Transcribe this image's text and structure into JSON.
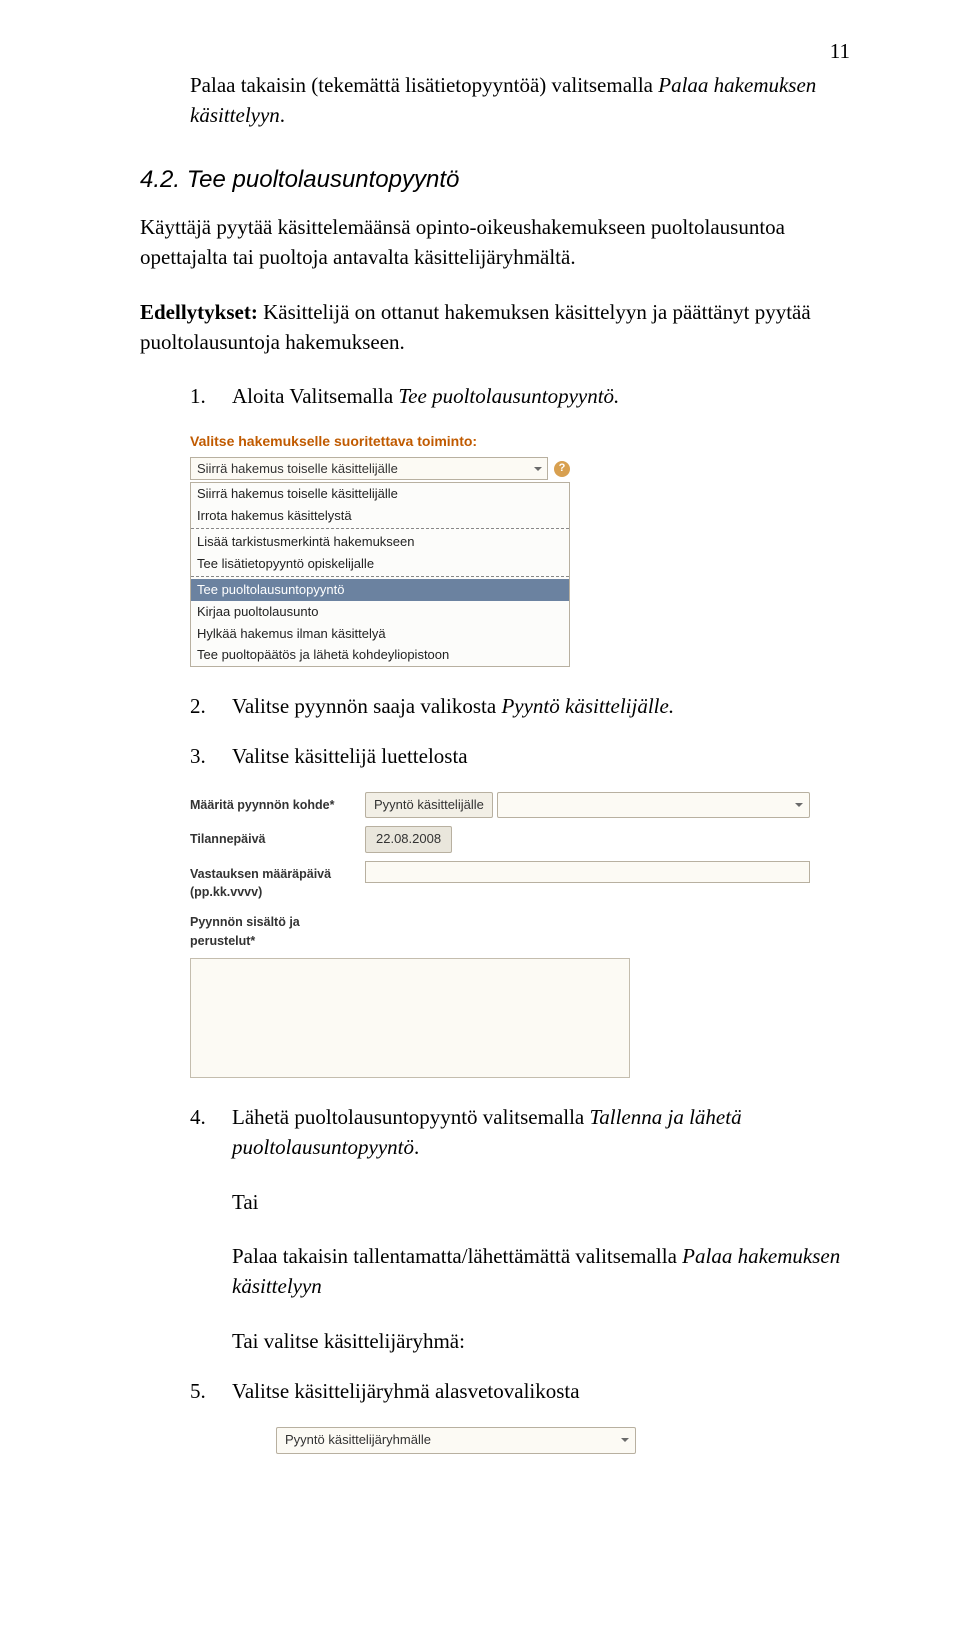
{
  "page_number": "11",
  "intro": {
    "line1_a": "Palaa takaisin (tekemättä lisätietopyyntöä) valitsemalla ",
    "line1_i": "Palaa hakemuksen käsittelyyn",
    "line1_b": "."
  },
  "section": {
    "num": "4.2.",
    "title": "Tee puoltolausuntopyyntö"
  },
  "p1": "Käyttäjä pyytää käsittelemäänsä opinto-oikeushakemukseen  puoltolausuntoa opettajalta tai puoltoja antavalta käsittelijäryhmältä.",
  "p2_a": "Edellytykset:",
  "p2_b": " Käsittelijä on ottanut hakemuksen käsittelyyn ja päättänyt pyytää puoltolausuntoja hakemukseen.",
  "steps": {
    "s1_a": "Aloita Valitsemalla ",
    "s1_i": "Tee puoltolausuntopyyntö.",
    "s2_a": "Valitse pyynnön saaja valikosta ",
    "s2_i": "Pyyntö käsittelijälle.",
    "s3": "Valitse käsittelijä luettelosta",
    "s4_a": "Lähetä puoltolausuntopyyntö valitsemalla ",
    "s4_i": "Tallenna ja lähetä puoltolausuntopyyntö",
    "s4_b": ".",
    "tai": "Tai",
    "s4c_a": "Palaa takaisin tallentamatta/lähettämättä valitsemalla ",
    "s4c_i": "Palaa hakemuksen käsittelyyn",
    "s4d": "Tai valitse käsittelijäryhmä:",
    "s5": "Valitse käsittelijäryhmä alasvetovalikosta"
  },
  "img1": {
    "title": "Valitse hakemukselle suoritettava toiminto:",
    "selected": "Siirrä hakemus toiselle käsittelijälle",
    "help": "?",
    "options": [
      "Siirrä hakemus toiselle käsittelijälle",
      "Irrota hakemus käsittelystä",
      "---",
      "Lisää tarkistusmerkintä hakemukseen",
      "Tee lisätietopyyntö opiskelijalle",
      "---",
      "Tee puoltolausuntopyyntö",
      "Kirjaa puoltolausunto",
      "Hylkää hakemus ilman käsittelyä",
      "Tee puoltopäätös ja lähetä kohdeyliopistoon"
    ],
    "highlight_index": 6
  },
  "img2": {
    "r1": "Määritä pyynnön kohde*",
    "r1v": "Pyyntö käsittelijälle",
    "r2": "Tilannepäivä",
    "r2v": "22.08.2008",
    "r3": "Vastauksen määräpäivä (pp.kk.vvvv)",
    "r4": "Pyynnön sisältö ja perustelut*"
  },
  "img3": {
    "text": "Pyyntö käsittelijäryhmälle"
  }
}
